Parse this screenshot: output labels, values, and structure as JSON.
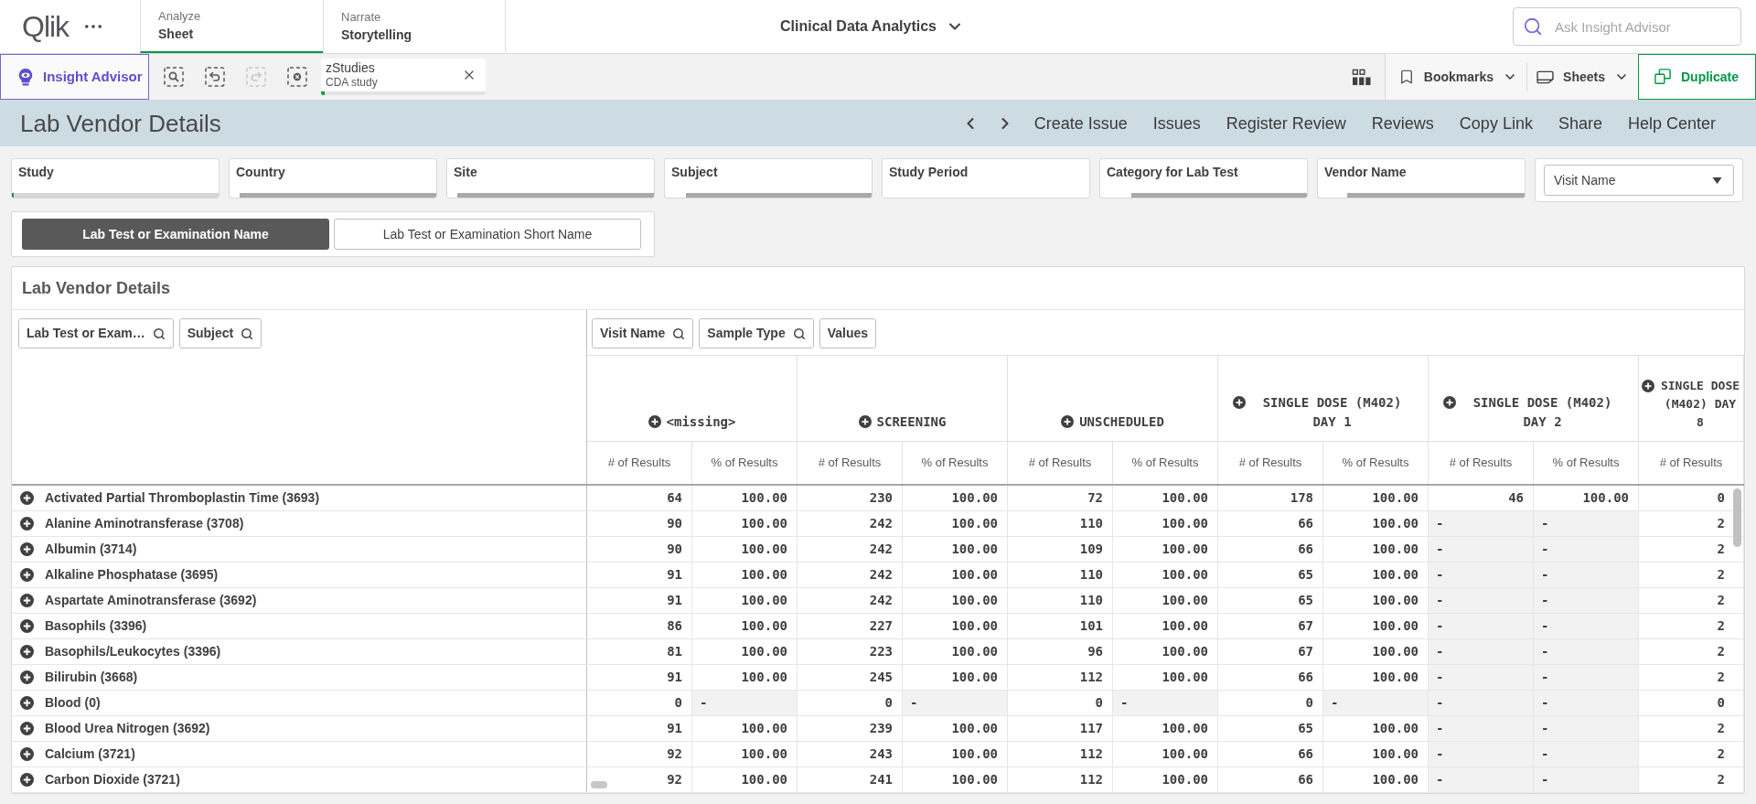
{
  "topbar": {
    "logo": "Qlik",
    "tabs": [
      {
        "label": "Analyze",
        "value": "Sheet",
        "selected": true
      },
      {
        "label": "Narrate",
        "value": "Storytelling",
        "selected": false
      }
    ],
    "app_title": "Clinical Data Analytics",
    "search": {
      "placeholder": "Ask Insight Advisor"
    }
  },
  "toolbar": {
    "insight_advisor": "Insight Advisor",
    "tools": [
      {
        "kind": "search",
        "disabled": false
      },
      {
        "kind": "back",
        "disabled": false
      },
      {
        "kind": "forward",
        "disabled": true
      },
      {
        "kind": "clear",
        "disabled": false
      }
    ],
    "selection": {
      "field": "zStudies",
      "value": "CDA study",
      "level": 0.02
    },
    "bookmarks": "Bookmarks",
    "sheets": "Sheets",
    "duplicate": "Duplicate"
  },
  "sheet": {
    "title": "Lab Vendor Details",
    "links": [
      "Create Issue",
      "Issues",
      "Register Review",
      "Reviews",
      "Copy Link",
      "Share",
      "Help Center"
    ]
  },
  "filters": [
    {
      "label": "Study",
      "selected": true,
      "level": 0.01
    },
    {
      "label": "Country",
      "selected": false,
      "level": 0.05
    },
    {
      "label": "Site",
      "selected": false,
      "level": 0.05
    },
    {
      "label": "Subject",
      "selected": false,
      "level": 0.1
    },
    {
      "label": "Study Period",
      "selected": false,
      "level": 1
    },
    {
      "label": "Category for Lab Test",
      "selected": false,
      "level": 0.15
    },
    {
      "label": "Vendor Name",
      "selected": false,
      "level": 0.14
    }
  ],
  "dropdown": {
    "value": "Visit Name"
  },
  "toggle": [
    {
      "label": "Lab Test or Examination Name",
      "selected": true
    },
    {
      "label": "Lab Test or Examination Short Name",
      "selected": false
    }
  ],
  "table": {
    "title": "Lab Vendor Details",
    "row_dimensions": [
      "Lab Test or Exam…",
      "Subject"
    ],
    "column_dimensions": [
      {
        "label": "Visit Name",
        "search": true
      },
      {
        "label": "Sample Type",
        "search": true
      },
      {
        "label": "Values",
        "search": false
      }
    ],
    "groups": [
      {
        "label": "<missing>",
        "subcolumns": [
          "# of Results",
          "% of Results"
        ]
      },
      {
        "label": "SCREENING",
        "subcolumns": [
          "# of Results",
          "% of Results"
        ]
      },
      {
        "label": "UNSCHEDULED",
        "subcolumns": [
          "# of Results",
          "% of Results"
        ]
      },
      {
        "label": "SINGLE DOSE (M402) DAY 1",
        "subcolumns": [
          "# of Results",
          "% of Results"
        ]
      },
      {
        "label": "SINGLE DOSE (M402) DAY 2",
        "subcolumns": [
          "# of Results",
          "% of Results"
        ]
      },
      {
        "label": "SINGLE DOSE (M402) DAY 8",
        "subcolumns": [
          "# of Results"
        ]
      }
    ],
    "rows": [
      {
        "label": "Activated Partial Thromboplastin Time (3693)",
        "cells": [
          "64",
          "100.00",
          "230",
          "100.00",
          "72",
          "100.00",
          "178",
          "100.00",
          "46",
          "100.00",
          "0"
        ]
      },
      {
        "label": "Alanine Aminotransferase (3708)",
        "cells": [
          "90",
          "100.00",
          "242",
          "100.00",
          "110",
          "100.00",
          "66",
          "100.00",
          {
            "text": "-",
            "null": true
          },
          {
            "text": "-",
            "null": true
          },
          "2"
        ]
      },
      {
        "label": "Albumin (3714)",
        "cells": [
          "90",
          "100.00",
          "242",
          "100.00",
          "109",
          "100.00",
          "66",
          "100.00",
          {
            "text": "-",
            "null": true
          },
          {
            "text": "-",
            "null": true
          },
          "2"
        ]
      },
      {
        "label": "Alkaline Phosphatase (3695)",
        "cells": [
          "91",
          "100.00",
          "242",
          "100.00",
          "110",
          "100.00",
          "65",
          "100.00",
          {
            "text": "-",
            "null": true
          },
          {
            "text": "-",
            "null": true
          },
          "2"
        ]
      },
      {
        "label": "Aspartate Aminotransferase (3692)",
        "cells": [
          "91",
          "100.00",
          "242",
          "100.00",
          "110",
          "100.00",
          "65",
          "100.00",
          {
            "text": "-",
            "null": true
          },
          {
            "text": "-",
            "null": true
          },
          "2"
        ]
      },
      {
        "label": "Basophils (3396)",
        "cells": [
          "86",
          "100.00",
          "227",
          "100.00",
          "101",
          "100.00",
          "67",
          "100.00",
          {
            "text": "-",
            "null": true
          },
          {
            "text": "-",
            "null": true
          },
          "2"
        ]
      },
      {
        "label": "Basophils/Leukocytes (3396)",
        "cells": [
          "81",
          "100.00",
          "223",
          "100.00",
          "96",
          "100.00",
          "67",
          "100.00",
          {
            "text": "-",
            "null": true
          },
          {
            "text": "-",
            "null": true
          },
          "2"
        ]
      },
      {
        "label": "Bilirubin (3668)",
        "cells": [
          "91",
          "100.00",
          "245",
          "100.00",
          "112",
          "100.00",
          "66",
          "100.00",
          {
            "text": "-",
            "null": true
          },
          {
            "text": "-",
            "null": true
          },
          "2"
        ]
      },
      {
        "label": "Blood (0)",
        "cells": [
          "0",
          {
            "text": "-",
            "null": true
          },
          "0",
          {
            "text": "-",
            "null": true
          },
          "0",
          {
            "text": "-",
            "null": true
          },
          "0",
          {
            "text": "-",
            "null": true
          },
          {
            "text": "-",
            "null": true
          },
          {
            "text": "-",
            "null": true
          },
          "0"
        ]
      },
      {
        "label": "Blood Urea Nitrogen (3692)",
        "cells": [
          "91",
          "100.00",
          "239",
          "100.00",
          "117",
          "100.00",
          "65",
          "100.00",
          {
            "text": "-",
            "null": true
          },
          {
            "text": "-",
            "null": true
          },
          "2"
        ]
      },
      {
        "label": "Calcium (3721)",
        "cells": [
          "92",
          "100.00",
          "243",
          "100.00",
          "112",
          "100.00",
          "66",
          "100.00",
          {
            "text": "-",
            "null": true
          },
          {
            "text": "-",
            "null": true
          },
          "2"
        ]
      },
      {
        "label": "Carbon Dioxide (3721)",
        "cells": [
          "92",
          "100.00",
          "241",
          "100.00",
          "112",
          "100.00",
          "66",
          "100.00",
          {
            "text": "-",
            "null": true
          },
          {
            "text": "-",
            "null": true
          },
          "2"
        ]
      }
    ]
  }
}
